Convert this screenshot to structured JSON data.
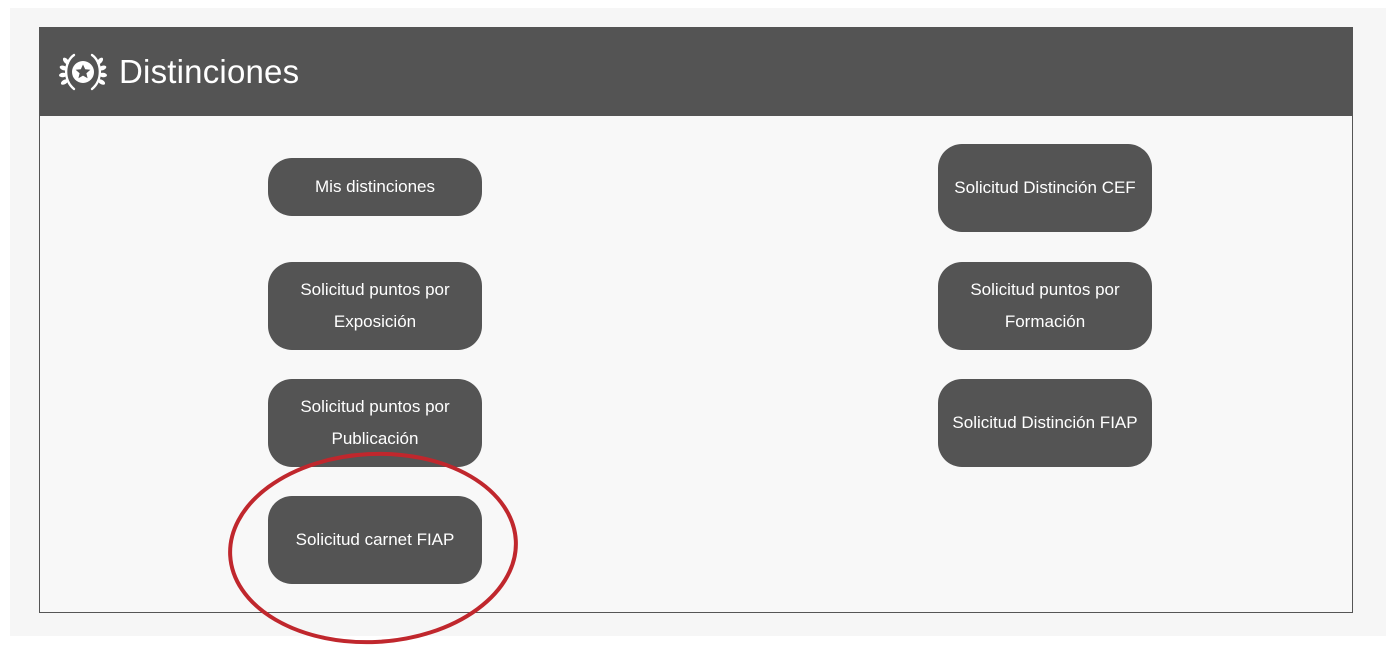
{
  "panel": {
    "title": "Distinciones",
    "icon": "laurel-star-icon"
  },
  "buttons": {
    "mis_distinciones": "Mis distinciones",
    "solicitud_distincion_cef": "Solicitud Distinción CEF",
    "solicitud_puntos_exposicion": "Solicitud puntos por Exposición",
    "solicitud_puntos_formacion": "Solicitud puntos por Formación",
    "solicitud_puntos_publicacion": "Solicitud puntos por Publicación",
    "solicitud_distincion_fiap": "Solicitud Distinción FIAP",
    "solicitud_carnet_fiap": "Solicitud carnet FIAP"
  },
  "colors": {
    "header_bg": "#545454",
    "button_bg": "#545454",
    "annotation": "#c0272d"
  }
}
